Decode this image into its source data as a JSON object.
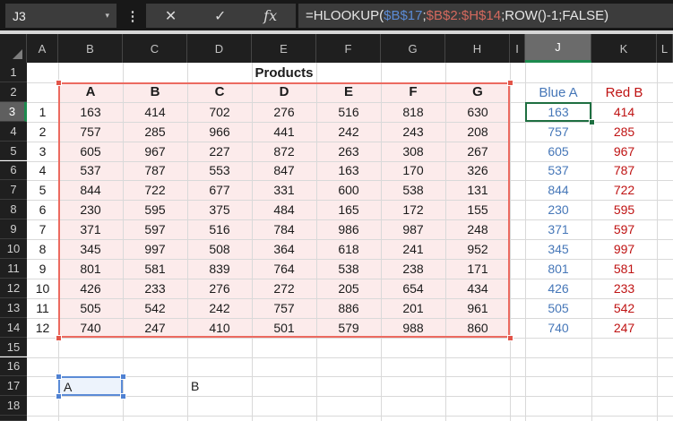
{
  "formula_bar": {
    "cell_reference": "J3",
    "buttons": {
      "cancel": "✕",
      "enter": "✓",
      "insert_function": "fx"
    },
    "formula_parts": [
      {
        "text": "=HLOOKUP(",
        "color": "#e6e6e6"
      },
      {
        "text": "$B$17",
        "color": "#5b8bd5"
      },
      {
        "text": ";",
        "color": "#e6e6e6"
      },
      {
        "text": "$B$2:$H$14",
        "color": "#d4695e"
      },
      {
        "text": ";ROW()-1;FALSE)",
        "color": "#e6e6e6"
      }
    ]
  },
  "grid": {
    "column_headers": [
      "A",
      "B",
      "C",
      "D",
      "E",
      "F",
      "G",
      "H",
      "I",
      "J",
      "K",
      "L"
    ],
    "row_headers": [
      1,
      2,
      3,
      4,
      5,
      6,
      7,
      8,
      9,
      10,
      11,
      12,
      13,
      14,
      15,
      16,
      17,
      18
    ],
    "active_column": "J",
    "active_row": 3
  },
  "sheet": {
    "title": "Products",
    "table": {
      "headers": [
        "A",
        "B",
        "C",
        "D",
        "E",
        "F",
        "G"
      ],
      "index": [
        1,
        2,
        3,
        4,
        5,
        6,
        7,
        8,
        9,
        10,
        11,
        12
      ],
      "rows": [
        [
          163,
          414,
          702,
          276,
          516,
          818,
          630
        ],
        [
          757,
          285,
          966,
          441,
          242,
          243,
          208
        ],
        [
          605,
          967,
          227,
          872,
          263,
          308,
          267
        ],
        [
          537,
          787,
          553,
          847,
          163,
          170,
          326
        ],
        [
          844,
          722,
          677,
          331,
          600,
          538,
          131
        ],
        [
          230,
          595,
          375,
          484,
          165,
          172,
          155
        ],
        [
          371,
          597,
          516,
          784,
          986,
          987,
          248
        ],
        [
          345,
          997,
          508,
          364,
          618,
          241,
          952
        ],
        [
          801,
          581,
          839,
          764,
          538,
          238,
          171
        ],
        [
          426,
          233,
          276,
          272,
          205,
          654,
          434
        ],
        [
          505,
          542,
          242,
          757,
          886,
          201,
          961
        ],
        [
          740,
          247,
          410,
          501,
          579,
          988,
          860
        ]
      ]
    },
    "lookup": {
      "blue_header": "Blue A",
      "red_header": "Red B",
      "blue_values": [
        163,
        757,
        605,
        537,
        844,
        230,
        371,
        345,
        801,
        426,
        505,
        740
      ],
      "red_values": [
        414,
        285,
        967,
        787,
        722,
        595,
        597,
        997,
        581,
        233,
        542,
        247
      ]
    },
    "criteria": {
      "b17": "A",
      "d17": "B"
    }
  },
  "selection": {
    "active_cell": "J3",
    "red_range": "B2:H14",
    "blue_cell": "B17"
  },
  "colors": {
    "active_cell_border": "#1e6f41",
    "header_accent_green": "#1d8a4e",
    "range_border_red": "#ec6a60",
    "range_fill_pink": "#fcebeb",
    "ref_border_blue": "#5b8bd6",
    "ref_fill_blue": "#edf3fc",
    "blue_text": "#4677b8",
    "red_text": "#bf1313"
  }
}
